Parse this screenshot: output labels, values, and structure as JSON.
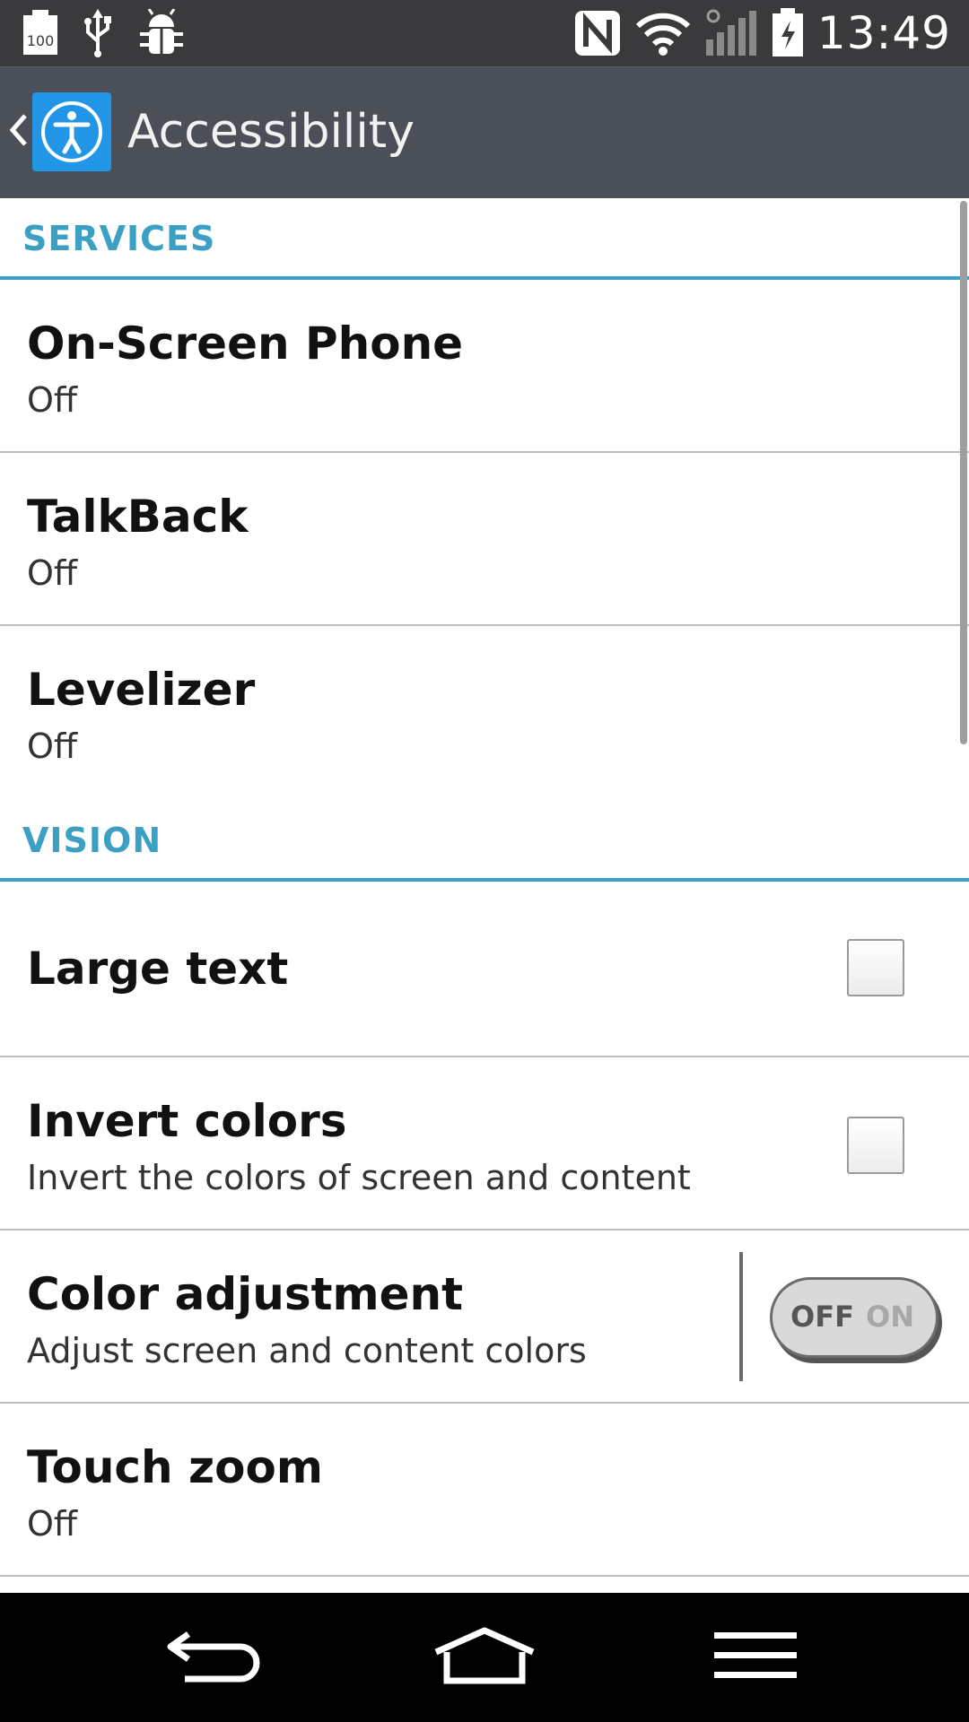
{
  "status_bar": {
    "battery_level_label": "100",
    "time": "13:49",
    "left_icons": [
      "battery-full-icon",
      "usb-icon",
      "android-debug-icon"
    ],
    "right_icons": [
      "nfc-icon",
      "wifi-icon",
      "signal-icon",
      "battery-charging-icon"
    ]
  },
  "action_bar": {
    "title": "Accessibility",
    "icon": "accessibility-icon",
    "colors": {
      "background": "#4b5058",
      "icon_bg": "#2196e6"
    }
  },
  "sections": [
    {
      "header": "SERVICES",
      "items": [
        {
          "title": "On-Screen Phone",
          "summary": "Off"
        },
        {
          "title": "TalkBack",
          "summary": "Off"
        },
        {
          "title": "Levelizer",
          "summary": "Off"
        }
      ]
    },
    {
      "header": "VISION",
      "items": [
        {
          "title": "Large text",
          "control": "checkbox",
          "checked": false
        },
        {
          "title": "Invert colors",
          "summary": "Invert the colors of screen and content",
          "control": "checkbox",
          "checked": false
        },
        {
          "title": "Color adjustment",
          "summary": "Adjust screen and content colors",
          "control": "switch",
          "state": "off",
          "switch_off_label": "OFF",
          "switch_on_label": "ON"
        },
        {
          "title": "Touch zoom",
          "summary": "Off"
        }
      ]
    }
  ],
  "accent_color": "#3ba0c4",
  "nav_bar": {
    "buttons": [
      "back-icon",
      "home-icon",
      "menu-icon"
    ]
  }
}
